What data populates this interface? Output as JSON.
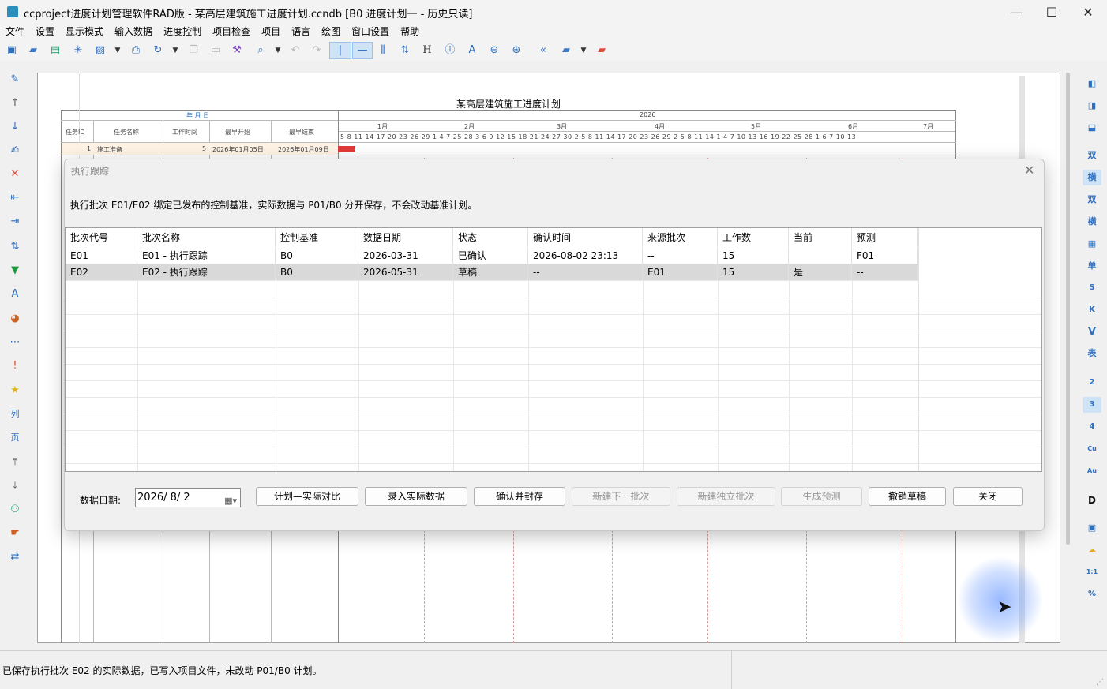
{
  "window": {
    "title": "ccproject进度计划管理软件RAD版 - 某高层建筑施工进度计划.ccndb [B0 进度计划一 - 历史只读]",
    "minimize": "—",
    "maximize": "☐",
    "close": "✕"
  },
  "menu": [
    "文件",
    "设置",
    "显示模式",
    "输入数据",
    "进度控制",
    "项目检查",
    "项目",
    "语言",
    "绘图",
    "窗口设置",
    "帮助"
  ],
  "plan": {
    "title": "某高层建筑施工进度计划",
    "ymd_label": "年 月 日",
    "year": "2026",
    "columns": [
      "任务ID",
      "任务名称",
      "工作时间",
      "最早开始",
      "最早结束"
    ],
    "months": [
      "1月",
      "2月",
      "3月",
      "4月",
      "5月",
      "6月",
      "7月"
    ],
    "days": "5 8 11 14 17 20 23 26 29 1 4 7 25 28 3 6 9 12 15 18 21 24 27 30 2 5 8 11 14 17 20 23 26 29 2 5 8 11 14 1 4 7 10 13 16 19 22 25 28 1 6 7 10 13",
    "task": {
      "id": "1",
      "name": "施工准备",
      "duration": "5",
      "start": "2026年01月05日",
      "end": "2026年01月09日"
    }
  },
  "dialog": {
    "title": "执行跟踪",
    "close": "✕",
    "info": "执行批次 E01/E02 绑定已发布的控制基准，实际数据与 P01/B0 分开保存，不会改动基准计划。",
    "headers": [
      "批次代号",
      "批次名称",
      "控制基准",
      "数据日期",
      "状态",
      "确认时间",
      "来源批次",
      "工作数",
      "当前",
      "预测"
    ],
    "rows": [
      [
        "E01",
        "E01 - 执行跟踪",
        "B0",
        "2026-03-31",
        "已确认",
        "2026-08-02 23:13",
        "--",
        "15",
        "",
        "F01"
      ],
      [
        "E02",
        "E02 - 执行跟踪",
        "B0",
        "2026-05-31",
        "草稿",
        "--",
        "E01",
        "15",
        "是",
        "--"
      ]
    ],
    "date_label": "数据日期:",
    "date_value": "2026/  8/  2",
    "buttons": {
      "compare": "计划—实际对比",
      "enter_actual": "录入实际数据",
      "confirm_seal": "确认并封存",
      "new_next": "新建下一批次",
      "new_independent": "新建独立批次",
      "forecast": "生成预测",
      "revoke_draft": "撤销草稿",
      "close": "关闭"
    }
  },
  "status": {
    "message": "已保存执行批次 E02 的实际数据，已写入项目文件，未改动 P01/B0 计划。"
  },
  "right_toolbar": [
    "双",
    "横",
    "双",
    "横",
    "单",
    "S",
    "K",
    "V",
    "表",
    "2",
    "3",
    "4",
    "Cu",
    "Au",
    "D",
    "1:1",
    "%"
  ]
}
